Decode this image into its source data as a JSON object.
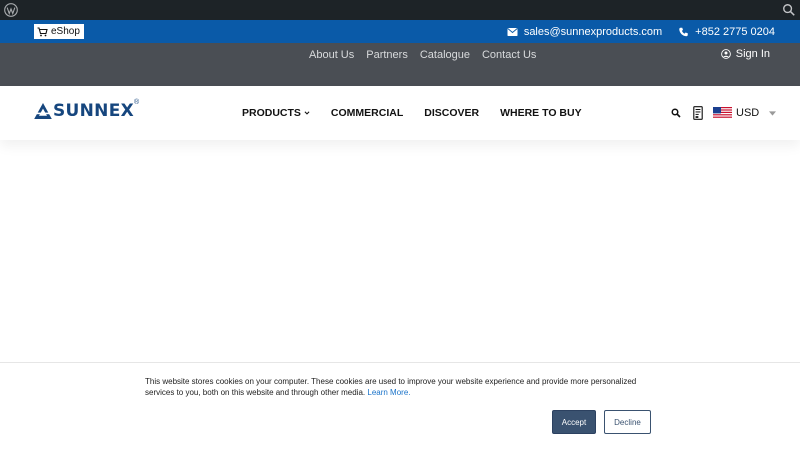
{
  "topbar": {
    "eshop_label": "eShop",
    "email": "sales@sunnexproducts.com",
    "phone": "+852 2775 0204"
  },
  "subnav": {
    "links": [
      "About Us",
      "Partners",
      "Catalogue",
      "Contact Us"
    ],
    "signin_label": "Sign In"
  },
  "header": {
    "logo_text": "SUNNEX",
    "logo_reg": "®",
    "nav": [
      "PRODUCTS",
      "COMMERCIAL",
      "DISCOVER",
      "WHERE TO BUY"
    ],
    "currency": "USD"
  },
  "cookie": {
    "message": "This website stores cookies on your computer. These cookies are used to improve your website experience and provide more personalized services to you, both on this website and through other media.",
    "learn_more": "Learn More.",
    "accept_label": "Accept",
    "decline_label": "Decline"
  },
  "colors": {
    "admin_bar": "#1d2327",
    "topbar_blue": "#0a5aa8",
    "subnav_gray": "#4a4e54",
    "logo_blue": "#16467e",
    "accept_button": "#3a5270"
  }
}
